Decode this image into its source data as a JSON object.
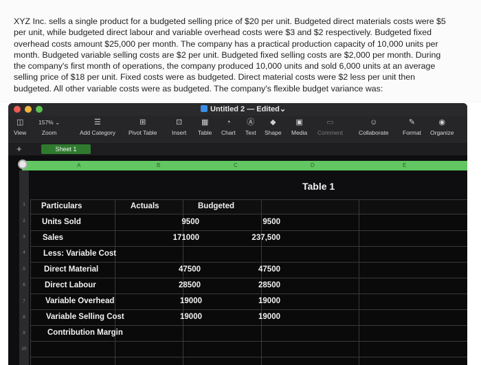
{
  "question": {
    "text": "XYZ Inc. sells a single product for a budgeted selling price of $20 per unit. Budgeted direct materials costs were $5 per unit, while budgeted direct labour and variable overhead costs were $3 and $2 respectively. Budgeted fixed overhead costs amount $25,000 per month. The company has a practical production capacity of 10,000 units per month. Budgeted variable selling costs are $2 per unit. Budgeted fixed selling costs are $2,000 per month. During the company's first month of operations, the company produced 10,000 units and sold 6,000 units at an average selling price of $18 per unit. Fixed costs were as budgeted. Direct material costs were $2 less per unit then budgeted. All other variable costs were as budgeted. The company's flexible budget variance was:"
  },
  "window": {
    "title": "Untitled 2",
    "status": "— Edited⌄"
  },
  "toolbar": {
    "view": "View",
    "zoom_value": "157% ⌄",
    "zoom": "Zoom",
    "add_category": "Add Category",
    "pivot_table": "Pivot Table",
    "insert": "Insert",
    "table": "Table",
    "chart": "Chart",
    "text": "Text",
    "shape": "Shape",
    "media": "Media",
    "comment": "Comment",
    "collaborate": "Collaborate",
    "format": "Format",
    "organize": "Organize"
  },
  "tabs": {
    "sheet": "Sheet 1",
    "add": "+"
  },
  "columns": [
    "A",
    "B",
    "C",
    "D",
    "E"
  ],
  "rows": [
    "1",
    "2",
    "3",
    "4",
    "5",
    "6",
    "7",
    "8",
    "9",
    "10"
  ],
  "table": {
    "title": "Table 1",
    "headers": {
      "particulars": "Particulars",
      "actuals": "Actuals",
      "budgeted": "Budgeted"
    },
    "rows": [
      {
        "label": "Units Sold",
        "actual": "9500",
        "budgeted": "9500"
      },
      {
        "label": "Sales",
        "actual": "171000",
        "budgeted": "237,500"
      },
      {
        "label": "Less: Variable Cost",
        "actual": "",
        "budgeted": ""
      },
      {
        "label": "Direct Material",
        "actual": "47500",
        "budgeted": "47500"
      },
      {
        "label": "Direct Labour",
        "actual": "28500",
        "budgeted": "28500"
      },
      {
        "label": "Variable Overhead",
        "actual": "19000",
        "budgeted": "19000"
      },
      {
        "label": "Variable Selling Cost",
        "actual": "19000",
        "budgeted": "19000"
      },
      {
        "label": "Contribution Margin",
        "actual": "",
        "budgeted": ""
      }
    ]
  }
}
